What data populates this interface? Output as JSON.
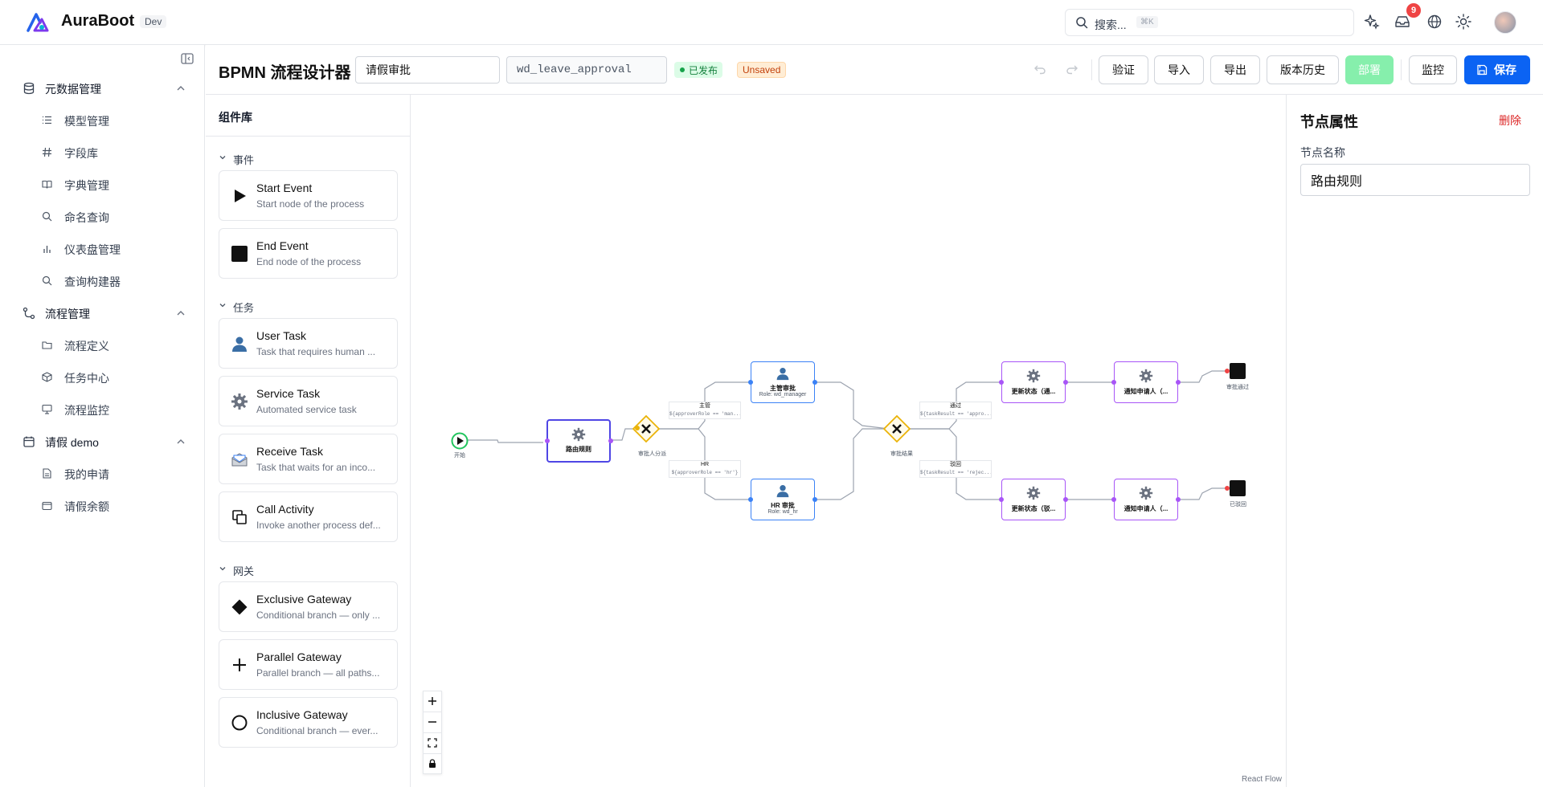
{
  "app": {
    "brand": "AuraBoot",
    "env": "Dev"
  },
  "header": {
    "search_placeholder": "搜索...",
    "search_shortcut": "⌘K",
    "notification_count": "9"
  },
  "sidebar": {
    "groups": [
      {
        "label": "元数据管理",
        "items": [
          "模型管理",
          "字段库",
          "字典管理",
          "命名查询",
          "仪表盘管理",
          "查询构建器"
        ]
      },
      {
        "label": "流程管理",
        "items": [
          "流程定义",
          "任务中心",
          "流程监控"
        ]
      },
      {
        "label": "请假 demo",
        "items": [
          "我的申请",
          "请假余额"
        ]
      }
    ]
  },
  "toolbar": {
    "title": "BPMN 流程设计器",
    "process_name": "请假审批",
    "process_key": "wd_leave_approval",
    "status": "已发布",
    "unsaved": "Unsaved",
    "validate": "验证",
    "import": "导入",
    "export": "导出",
    "history": "版本历史",
    "deploy": "部署",
    "monitor": "监控",
    "save": "保存"
  },
  "palette": {
    "title": "组件库",
    "sections": [
      {
        "label": "事件",
        "items": [
          {
            "name": "Start Event",
            "desc": "Start node of the process"
          },
          {
            "name": "End Event",
            "desc": "End node of the process"
          }
        ]
      },
      {
        "label": "任务",
        "items": [
          {
            "name": "User Task",
            "desc": "Task that requires human ..."
          },
          {
            "name": "Service Task",
            "desc": "Automated service task"
          },
          {
            "name": "Receive Task",
            "desc": "Task that waits for an inco..."
          },
          {
            "name": "Call Activity",
            "desc": "Invoke another process def..."
          }
        ]
      },
      {
        "label": "网关",
        "items": [
          {
            "name": "Exclusive Gateway",
            "desc": "Conditional branch — only ..."
          },
          {
            "name": "Parallel Gateway",
            "desc": "Parallel branch — all paths..."
          },
          {
            "name": "Inclusive Gateway",
            "desc": "Conditional branch — ever..."
          }
        ]
      }
    ]
  },
  "canvas": {
    "nodes": {
      "start_label": "开始",
      "route_rule": "路由规则",
      "gateway1_label": "审批人分派",
      "manager_task": "主管审批",
      "manager_role": "Role: wd_manager",
      "hr_task": "HR 审批",
      "hr_role": "Role: wd_hr",
      "gateway2_label": "审批结果",
      "update_pass": "更新状态（通...",
      "notify_pass": "通知申请人（...",
      "update_reject": "更新状态（驳...",
      "notify_reject": "通知申请人（...",
      "end_pass_label": "审批通过",
      "end_reject_label": "已驳回"
    },
    "edges": {
      "manager_label": "主管",
      "manager_cond": "${approverRole == 'man...",
      "hr_label": "HR",
      "hr_cond": "${approverRole == 'hr'}",
      "pass_label": "通过",
      "pass_cond": "${taskResult == 'appro...",
      "reject_label": "驳回",
      "reject_cond": "${taskResult == 'rejec..."
    },
    "attribution": "React Flow"
  },
  "properties": {
    "title": "节点属性",
    "delete": "删除",
    "name_label": "节点名称",
    "name_value": "路由规则"
  },
  "colors": {
    "primary": "#0b63f3",
    "selected_node": "#4f46e5",
    "user_task_border": "#3b82f6",
    "service_task_border": "#a855f7",
    "gateway": "#eab308",
    "start": "#22c55e",
    "end_dot": "#ef4444"
  }
}
